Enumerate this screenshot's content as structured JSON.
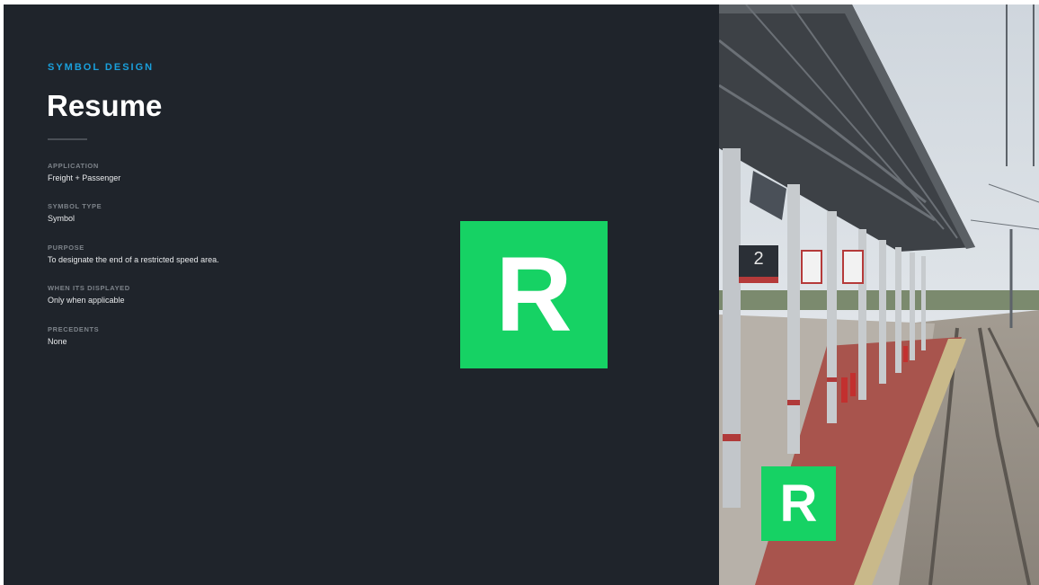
{
  "slide": {
    "eyebrow": "SYMBOL DESIGN",
    "title": "Resume",
    "fields": [
      {
        "label": "APPLICATION",
        "value": "Freight + Passenger"
      },
      {
        "label": "SYMBOL TYPE",
        "value": "Symbol"
      },
      {
        "label": "PURPOSE",
        "value": "To designate the end of a restricted speed area."
      },
      {
        "label": "WHEN ITS DISPLAYED",
        "value": "Only when applicable"
      },
      {
        "label": "PRECEDENTS",
        "value": "None"
      }
    ]
  },
  "symbol": {
    "letter": "R",
    "background_color": "#16d264",
    "letter_color": "#ffffff"
  },
  "photo": {
    "platform_number": "2",
    "overlay_symbol_letter": "R"
  },
  "colors": {
    "panel_background": "#1f242b",
    "eyebrow_accent": "#1aa0dc",
    "title_text": "#ffffff",
    "label_text": "#7d838a"
  }
}
